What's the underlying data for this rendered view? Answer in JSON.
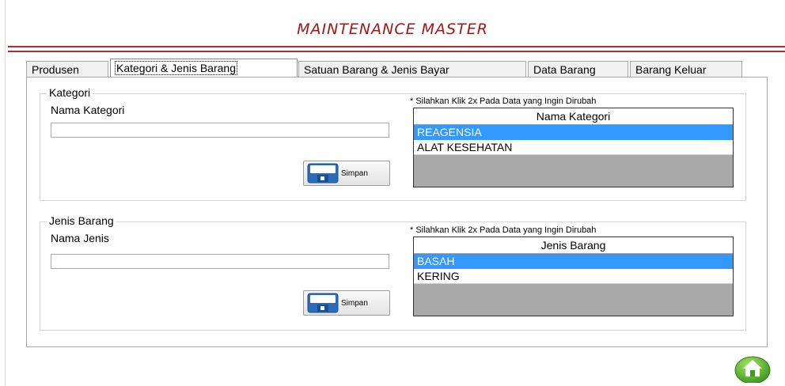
{
  "header": {
    "title": "MAINTENANCE MASTER"
  },
  "tabs": [
    {
      "label": "Produsen"
    },
    {
      "label": "Kategori & Jenis Barang"
    },
    {
      "label": "Satuan Barang & Jenis Bayar"
    },
    {
      "label": "Data Barang"
    },
    {
      "label": "Barang Keluar"
    }
  ],
  "active_tab": "Kategori & Jenis Barang",
  "kategori": {
    "group_title": "Kategori",
    "field_label": "Nama Kategori",
    "input_value": "",
    "save_label": "Simpan",
    "hint": "* Silahkan Klik 2x Pada Data yang Ingin Dirubah",
    "grid_header": "Nama Kategori",
    "rows": [
      {
        "value": "REAGENSIA",
        "selected": true
      },
      {
        "value": "ALAT KESEHATAN",
        "selected": false
      }
    ]
  },
  "jenis": {
    "group_title": "Jenis Barang",
    "field_label": "Nama Jenis",
    "input_value": "",
    "save_label": "Simpan",
    "hint": "* Silahkan Klik 2x Pada Data yang Ingin Dirubah",
    "grid_header": "Jenis Barang",
    "rows": [
      {
        "value": "BASAH",
        "selected": true
      },
      {
        "value": "KERING",
        "selected": false
      }
    ]
  },
  "icons": {
    "save": "floppy-disk-icon",
    "home": "home-icon"
  },
  "colors": {
    "title": "#a01818",
    "rule": "#b03030",
    "selection": "#3399ff",
    "grid_empty": "#a9a9a9",
    "home": "#5cb82e"
  }
}
